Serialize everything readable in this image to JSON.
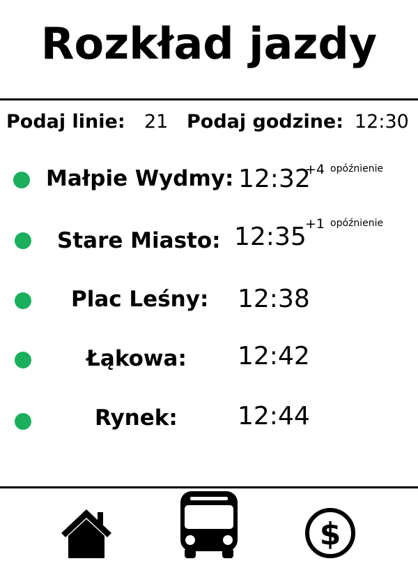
{
  "header": {
    "title": "Rozkład jazdy"
  },
  "query": {
    "line_label": "Podaj linie:",
    "line_value": "21",
    "time_label": "Podaj godzine:",
    "time_value": "12:30"
  },
  "stops": [
    {
      "name": "Małpie Wydmy:",
      "time": "12:32",
      "delay": "+4",
      "delay_label": "opóźnienie",
      "status_color": "#1aaf5d"
    },
    {
      "name": "Stare Miasto:",
      "time": "12:35",
      "delay": "+1",
      "delay_label": "opóźnienie",
      "status_color": "#1aaf5d"
    },
    {
      "name": "Plac Leśny:",
      "time": "12:38",
      "status_color": "#1aaf5d"
    },
    {
      "name": "Łąkowa:",
      "time": "12:42",
      "status_color": "#1aaf5d"
    },
    {
      "name": "Rynek:",
      "time": "12:44",
      "status_color": "#1aaf5d"
    }
  ],
  "nav": {
    "items": [
      {
        "icon": "home-icon"
      },
      {
        "icon": "bus-icon"
      },
      {
        "icon": "dollar-icon"
      }
    ]
  }
}
